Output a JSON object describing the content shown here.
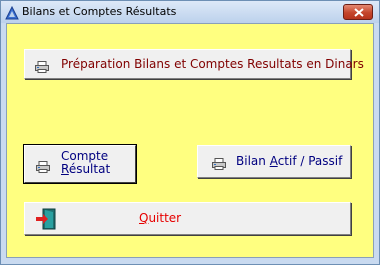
{
  "window": {
    "title": "Bilans et Comptes Résultats",
    "close_label": "Fermer"
  },
  "buttons": {
    "preparation": "Préparation Bilans et Comptes Resultats en Dinars",
    "compte_line1": "Compte",
    "compte_line2_u": "R",
    "compte_line2_rest": "ésultat",
    "bilan_pre": "Bilan ",
    "bilan_u": "A",
    "bilan_rest": "ctif / Passif",
    "quitter_u": "Q",
    "quitter_rest": "uitter"
  },
  "colors": {
    "client_background": "#ffff80",
    "label_dark_red": "#800000",
    "label_navy": "#000080",
    "label_red": "#e60000"
  },
  "icons": {
    "app": "triangle-app-icon",
    "close": "close-icon",
    "print": "printer-icon",
    "exit": "exit-door-icon"
  }
}
